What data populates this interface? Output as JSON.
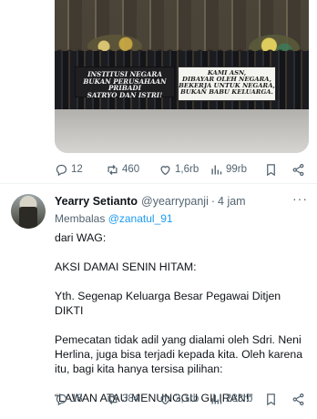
{
  "banners": {
    "left_lines": [
      "INSTITUSI NEGARA",
      "BUKAN PERUSAHAAN PRIBADI",
      "SATRYO DAN ISTRI!"
    ],
    "right_lines": [
      "KAMI ASN,",
      "DIBAYAR OLEH NEGARA,",
      "BEKERJA UNTUK NEGARA,",
      "BUKAN BABU KELUARGA."
    ]
  },
  "tweet1_actions": {
    "replies": "12",
    "reposts": "460",
    "likes": "1,6rb",
    "views": "99rb"
  },
  "tweet2": {
    "name": "Yearry Setianto",
    "handle": "@yearrypanji",
    "separator": "·",
    "time": "4 jam",
    "more": "···",
    "replying_prefix": "Membalas",
    "replying_to": "@zanatul_91",
    "paragraphs": [
      "dari WAG:",
      "AKSI DAMAI SENIN HITAM:",
      "Yth. Segenap Keluarga Besar Pegawai Ditjen DIKTI",
      "Pemecatan tidak adil yang dialami oleh Sdri. Neni Herlina, juga bisa terjadi kepada kita. Oleh karena itu, bagi kita hanya tersisa pilihan:",
      "“LAWAN ATAU MENUNGGU GILIRAN!”"
    ],
    "actions": {
      "replies": "18",
      "reposts": "384",
      "likes": "2,1rb",
      "views": "233rb"
    }
  },
  "colors": {
    "text": "#0f1419",
    "secondary": "#536471",
    "link": "#1d9bf0",
    "divider": "#eff3f4"
  }
}
